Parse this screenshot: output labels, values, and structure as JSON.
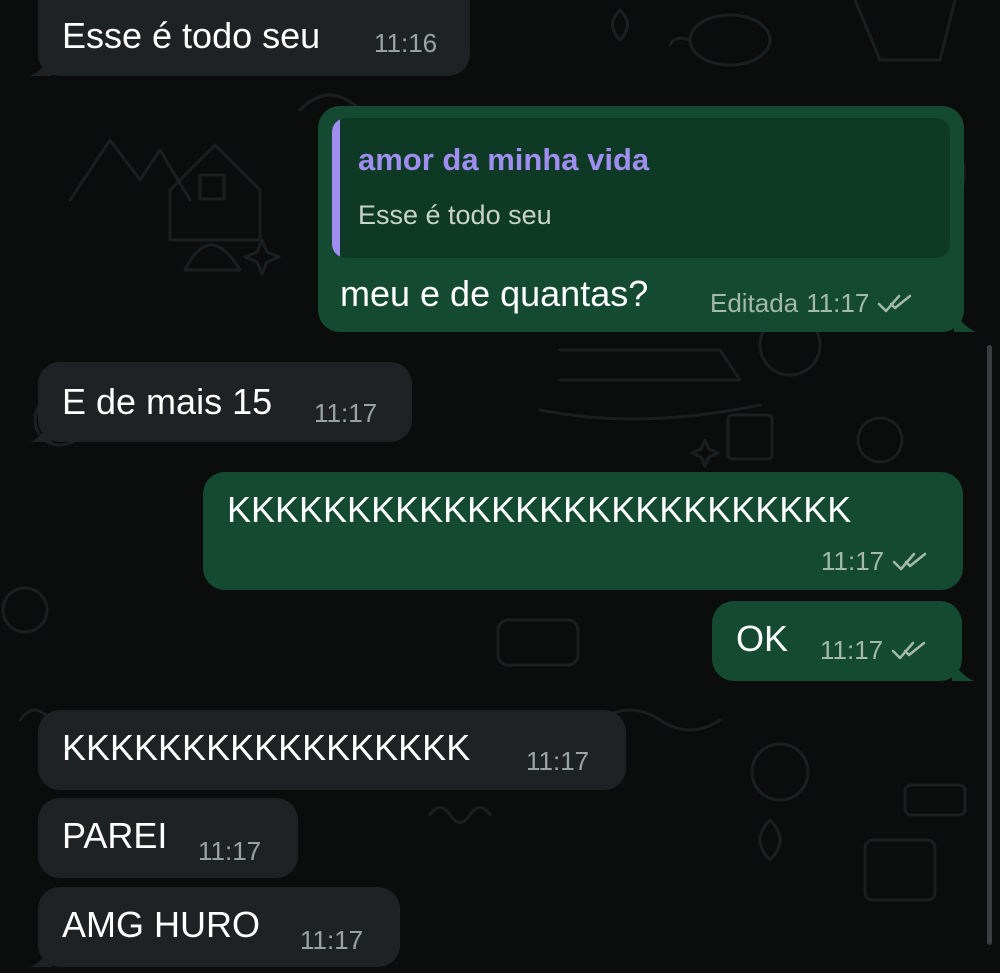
{
  "chat": {
    "messages": [
      {
        "direction": "incoming",
        "text": "Esse é todo seu",
        "time": "11:16"
      },
      {
        "direction": "outgoing",
        "reply": {
          "author": "amor da minha vida",
          "text": "Esse é todo seu"
        },
        "text": "meu e de quantas?",
        "edited_label": "Editada",
        "time": "11:17",
        "status": "read"
      },
      {
        "direction": "incoming",
        "text": "E de mais 15",
        "time": "11:17"
      },
      {
        "direction": "outgoing",
        "text": "KKKKKKKKKKKKKKKKKKKKKKKKKK",
        "time": "11:17",
        "status": "read"
      },
      {
        "direction": "outgoing",
        "text": "OK",
        "time": "11:17",
        "status": "read"
      },
      {
        "direction": "incoming",
        "text": "KKKKKKKKKKKKKKKKK",
        "time": "11:17"
      },
      {
        "direction": "incoming",
        "text": "PAREI",
        "time": "11:17"
      },
      {
        "direction": "incoming",
        "text": "AMG HURO",
        "time": "11:17"
      }
    ]
  },
  "colors": {
    "background": "#0b0c0c",
    "incoming_bubble": "#1f2224",
    "outgoing_bubble": "#134a31",
    "reply_author": "#9f8ef0",
    "read_check": "#a4b8ad"
  },
  "icons": {
    "read_status": "double-check-icon",
    "wallpaper": "doodle-pattern"
  }
}
